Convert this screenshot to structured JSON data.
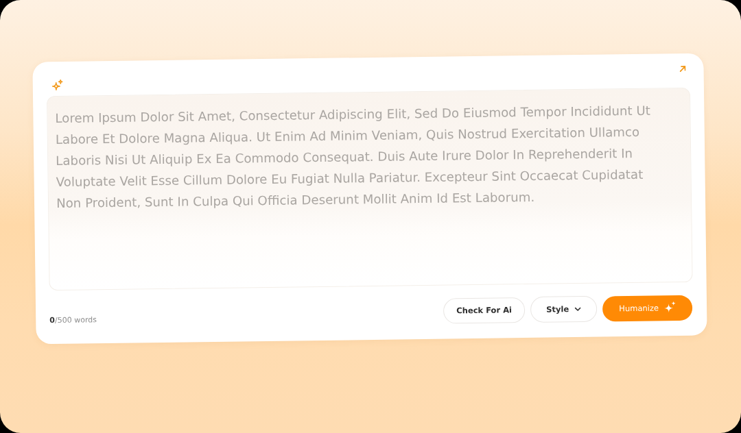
{
  "editor": {
    "placeholder": "Lorem Ipsum Dolor Sit Amet, Consectetur Adipiscing Elit, Sed Do Eiusmod Tempor Incididunt Ut Labore Et Dolore Magna Aliqua. Ut Enim Ad Minim Veniam, Quis Nostrud Exercitation Ullamco Laboris Nisi Ut Aliquip Ex Ea Commodo Consequat. Duis Aute Irure Dolor In Reprehenderit In Voluptate Velit Esse Cillum Dolore Eu Fugiat Nulla Pariatur. Excepteur Sint Occaecat Cupidatat Non Proident, Sunt In Culpa Qui Officia Deserunt Mollit Anim Id Est Laborum.",
    "word_count": "**0**/500 words"
  },
  "buttons": [
    {
      "kind": "outline",
      "label": "Check For Ai"
    },
    {
      "kind": "dropdown",
      "label": "Style"
    },
    {
      "kind": "primary",
      "label": "Humanize"
    }
  ]
}
